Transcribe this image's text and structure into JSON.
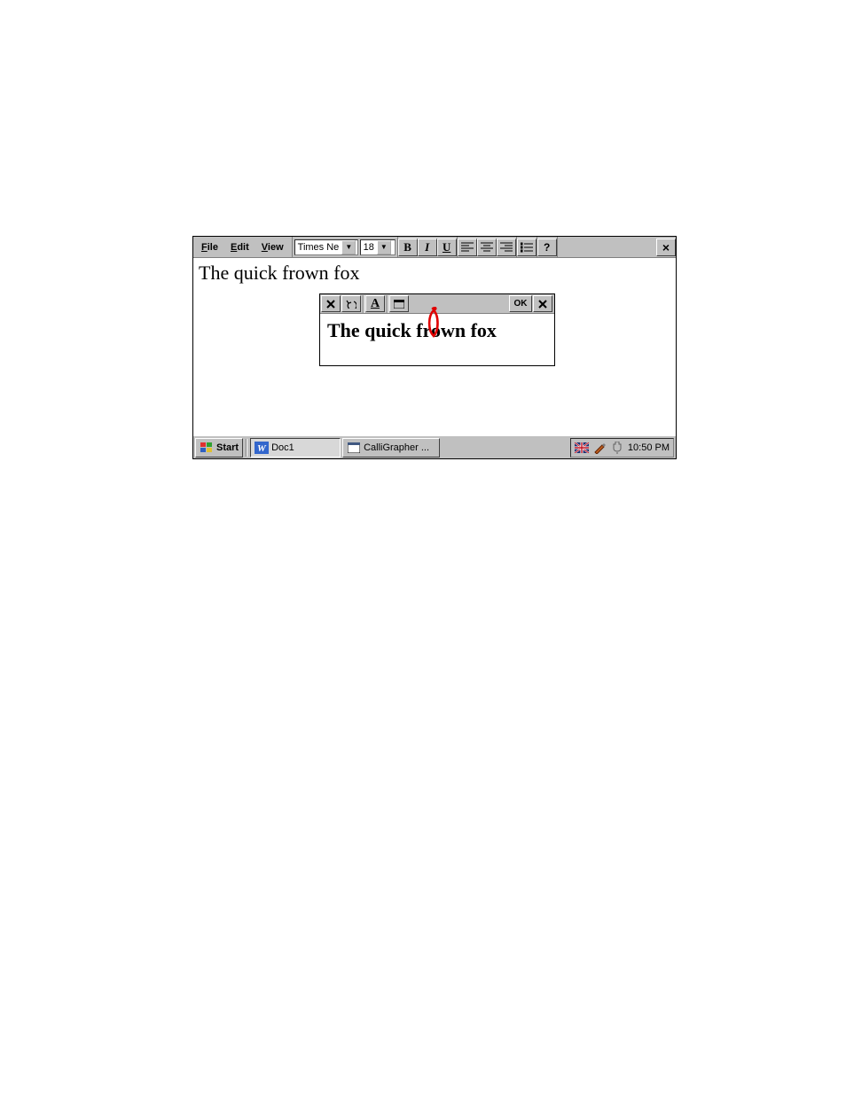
{
  "menu": {
    "file": "File",
    "edit": "Edit",
    "view": "View"
  },
  "toolbar": {
    "font_name": "Times Ne",
    "font_size": "18",
    "bold": "B",
    "italic": "I",
    "underline": "U",
    "help": "?",
    "close": "×"
  },
  "document": {
    "text": "The quick frown fox"
  },
  "popup": {
    "ok": "OK",
    "close": "×",
    "text_before": "The quick ",
    "text_marked": "f",
    "text_after": "rown fox"
  },
  "taskbar": {
    "start": "Start",
    "app1": "Doc1",
    "app2": "CalliGrapher ...",
    "clock": "10:50 PM"
  }
}
